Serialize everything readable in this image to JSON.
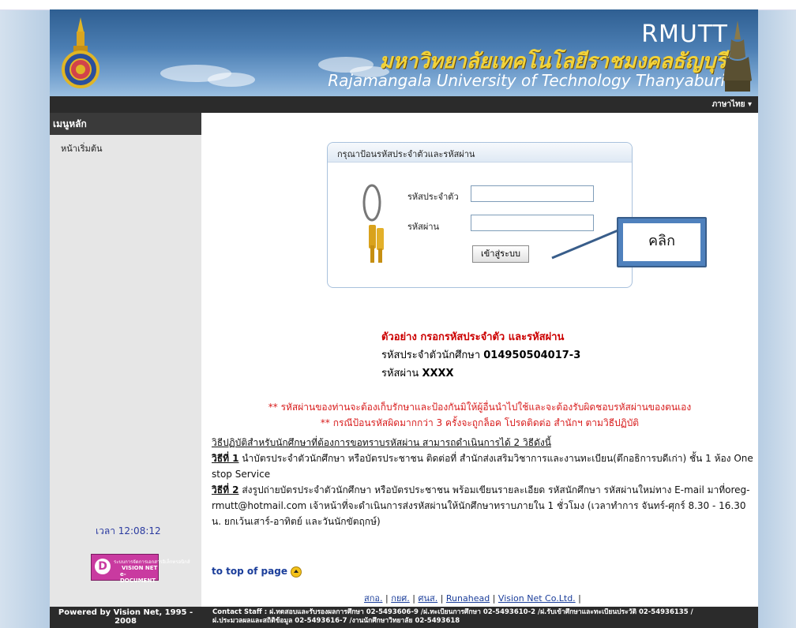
{
  "header": {
    "brand_short": "RMUTT",
    "brand_thai": "มหาวิทยาลัยเทคโนโลยีราชมงคลธัญบุรี",
    "brand_en": "Rajamangala University of Technology Thanyaburi",
    "language": "ภาษาไทย"
  },
  "sidebar": {
    "menu_title": "เมนูหลัก",
    "items": [
      {
        "label": "หน้าเริ่มต้น"
      }
    ],
    "clock": "เวลา 12:08:12",
    "badge_top": "ระบบการจัดการเอกสารอิเล็กทรอนิกส์",
    "badge_line1": "VISION NET",
    "badge_line2": "e-DOCUMENT"
  },
  "login": {
    "title": "กรุณาป้อนรหัสประจำตัวและรหัสผ่าน",
    "id_label": "รหัสประจำตัว",
    "password_label": "รหัสผ่าน",
    "id_value": "",
    "password_value": "",
    "submit_label": "เข้าสู่ระบบ"
  },
  "callout": {
    "label": "คลิก"
  },
  "example": {
    "title": "ตัวอย่าง กรอกรหัสประจำตัว และรหัสผ่าน",
    "id_prefix": "รหัสประจำตัวนักศึกษา ",
    "id_value": "014950504017-3",
    "pw_prefix": "รหัสผ่าน ",
    "pw_value": "XXXX"
  },
  "warnings": [
    "** รหัสผ่านของท่านจะต้องเก็บรักษาและป้องกันมิให้ผู้อื่นนำไปใช้และจะต้องรับผิดชอบรหัสผ่านของตนเอง",
    "** กรณีป้อนรหัสผิดมากกว่า 3 ครั้งจะถูกล็อค โปรดติดต่อ สำนักฯ ตามวิธีปฏิบัติ"
  ],
  "instructions": {
    "heading": "วิธีปฏิบัติสำหรับนักศึกษาที่ต้องการขอทราบรหัสผ่าน สามารถดำเนินการได้ 2 วิธีดังนี้",
    "method1_label": "วิธีที่ 1",
    "method1_text": " นำบัตรประจำตัวนักศึกษา หรือบัตรประชาชน ติดต่อที่ สำนักส่งเสริมวิชาการและงานทะเบียน(ตึกอธิการบดีเก่า) ชั้น 1 ห้อง One stop Service",
    "method2_label": "วิธีที่ 2",
    "method2_text": " ส่งรูปถ่ายบัตรประจำตัวนักศึกษา หรือบัตรประชาชน พร้อมเขียนรายละเอียด รหัสนักศึกษา รหัสผ่านใหม่ทาง E-mail มาที่oreg-rmutt@hotmail.com เจ้าหน้าที่จะดำเนินการส่งรหัสผ่านให้นักศึกษาทราบภายใน 1 ชั่วโมง (เวลาทำการ จันทร์-ศุกร์ 8.30 - 16.30 น. ยกเว้นเสาร์-อาทิตย์ และวันนักขัตฤกษ์)"
  },
  "top_link": "to top of page",
  "footer_links": [
    "สกอ.",
    "กยศ.",
    "ศนส.",
    "Runahead",
    "Vision Net Co.Ltd."
  ],
  "footer": {
    "powered": "Powered by Vision Net, 1995 - 2008",
    "contact_line1": "Contact Staff : ฝ.ทดสอบและรับรองผลการศึกษา 02-5493606-9 /ฝ.ทะเบียนการศึกษา 02-5493610-2 /ฝ.รับเข้าศึกษาและทะเบียนประวัติ 02-54936135 /",
    "contact_line2": "ฝ.ประมวลผลและสถิติข้อมูล 02-5493616-7 /งานนักศึกษาวิทยาลัย 02-5493618"
  }
}
